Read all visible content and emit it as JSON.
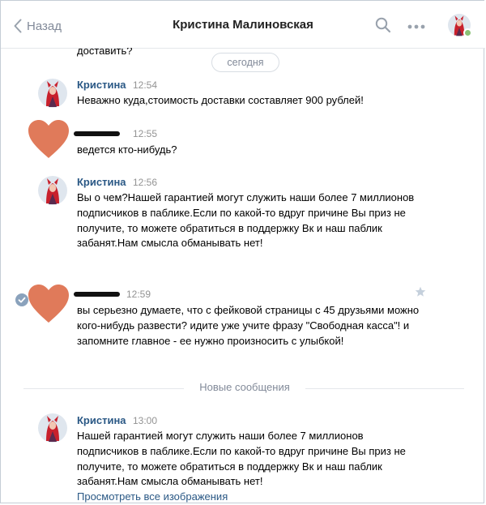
{
  "header": {
    "back_label": "Назад",
    "title": "Кристина Малиновская"
  },
  "chat": {
    "cut_text": "доставить?",
    "date_label": "сегодня",
    "new_messages_label": "Новые сообщения",
    "messages": [
      {
        "author": "Кристина",
        "time": "12:54",
        "text": "Неважно куда,стоимость доставки составляет 900 рублей!"
      },
      {
        "author": "",
        "time": "12:55",
        "text": "ведется кто-нибудь?"
      },
      {
        "author": "Кристина",
        "time": "12:56",
        "text": "Вы о чем?Нашей гарантией могут служить наши более 7 миллионов подписчиков в паблике.Если по какой-то вдруг причине Вы приз не получите, то можете обратиться в поддержку Вк и наш паблик забанят.Нам смысла обманывать нет!"
      },
      {
        "author": "",
        "time": "12:59",
        "text": "вы серьезно думаете, что с фейковой страницы с 45 друзьями можно кого-нибудь развести? идите уже учите фразу \"Свободная касса\"! и запомните главное - ее нужно произносить с улыбкой!"
      },
      {
        "author": "Кристина",
        "time": "13:00",
        "text": "Нашей гарантией могут служить наши более 7 миллионов подписчиков в паблике.Если по какой-то вдруг причине Вы приз не получите, то можете обратиться в поддержку Вк и наш паблик забанят.Нам смысла обманывать нет!"
      }
    ],
    "view_images_link": "Просмотреть все изображения"
  },
  "colors": {
    "link": "#2a5885",
    "muted": "#828a99",
    "heart": "#e07a5a",
    "avatar_red": "#c8202c"
  },
  "icons": [
    "back-chevron-icon",
    "search-icon",
    "more-dots-icon",
    "online-indicator-icon",
    "check-circle-icon",
    "star-icon",
    "heart-avatar-icon"
  ]
}
